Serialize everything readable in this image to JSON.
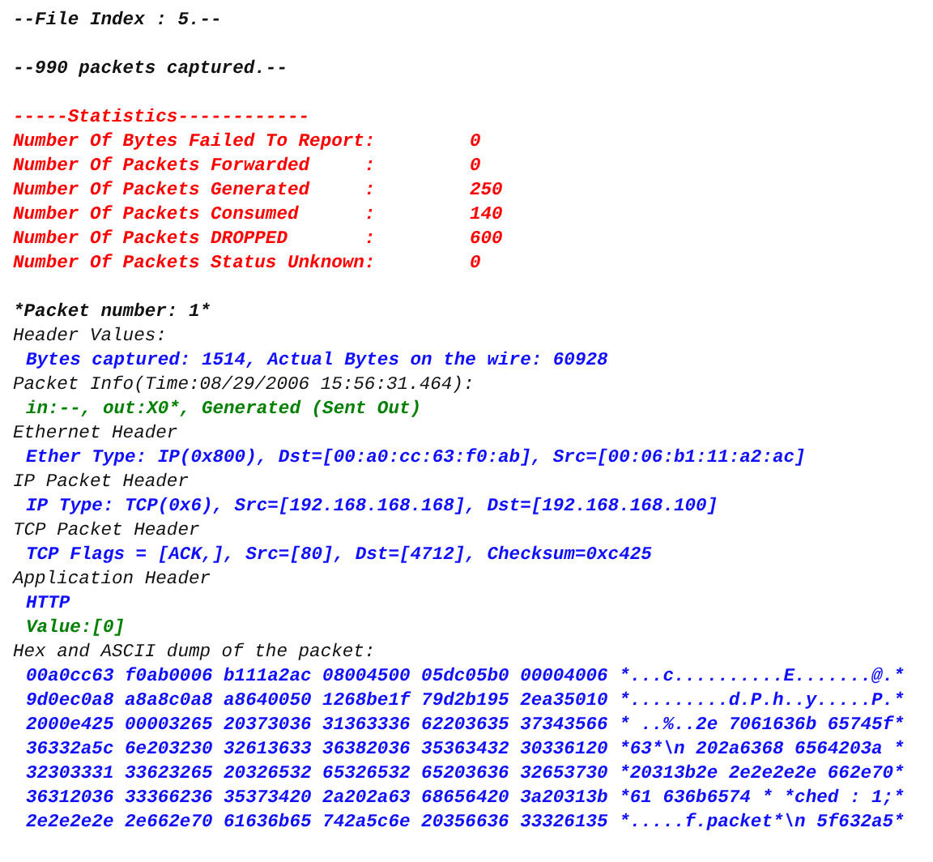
{
  "file_index": "--File Index : 5.--",
  "capture_summary": "--990 packets captured.--",
  "statistics": {
    "title": "-----Statistics------------",
    "rows": [
      {
        "label": "Number Of Bytes Failed To Report:",
        "value": "0"
      },
      {
        "label": "Number Of Packets Forwarded     :",
        "value": "0"
      },
      {
        "label": "Number Of Packets Generated     :",
        "value": "250"
      },
      {
        "label": "Number Of Packets Consumed      :",
        "value": "140"
      },
      {
        "label": "Number Of Packets DROPPED       :",
        "value": "600"
      },
      {
        "label": "Number Of Packets Status Unknown:",
        "value": "0"
      }
    ]
  },
  "packet": {
    "title": "*Packet number: 1*",
    "sections": [
      {
        "heading": "Header Values:",
        "details": [
          {
            "kind": "info",
            "text": "Bytes captured: 1514, Actual Bytes on the wire: 60928"
          }
        ]
      },
      {
        "heading": "Packet Info(Time:08/29/2006 15:56:31.464):",
        "details": [
          {
            "kind": "status",
            "text": "in:--, out:X0*, Generated (Sent Out)"
          }
        ]
      },
      {
        "heading": "Ethernet Header",
        "details": [
          {
            "kind": "info",
            "text": "Ether Type: IP(0x800), Dst=[00:a0:cc:63:f0:ab], Src=[00:06:b1:11:a2:ac]"
          }
        ]
      },
      {
        "heading": "IP Packet Header",
        "details": [
          {
            "kind": "info",
            "text": "IP Type: TCP(0x6), Src=[192.168.168.168], Dst=[192.168.168.100]"
          }
        ]
      },
      {
        "heading": "TCP Packet Header",
        "details": [
          {
            "kind": "info",
            "text": "TCP Flags = [ACK,], Src=[80], Dst=[4712], Checksum=0xc425"
          }
        ]
      },
      {
        "heading": "Application Header",
        "details": [
          {
            "kind": "info",
            "text": "HTTP"
          },
          {
            "kind": "status",
            "text": "Value:[0]"
          }
        ]
      }
    ],
    "dump": {
      "heading": "Hex and ASCII dump of the packet:",
      "lines": [
        "00a0cc63 f0ab0006 b111a2ac 08004500 05dc05b0 00004006 *...c..........E.......@.*",
        "9d0ec0a8 a8a8c0a8 a8640050 1268be1f 79d2b195 2ea35010 *.........d.P.h..y.....P.*",
        "2000e425 00003265 20373036 31363336 62203635 37343566 * ..%..2e 7061636b 65745f*",
        "36332a5c 6e203230 32613633 36382036 35363432 30336120 *63*\\n 202a6368 6564203a *",
        "32303331 33623265 20326532 65326532 65203636 32653730 *20313b2e 2e2e2e2e 662e70*",
        "36312036 33366236 35373420 2a202a63 68656420 3a20313b *61 636b6574 * *ched : 1;*",
        "2e2e2e2e 2e662e70 61636b65 742a5c6e 20356636 33326135 *.....f.packet*\\n 5f632a5*"
      ]
    }
  }
}
